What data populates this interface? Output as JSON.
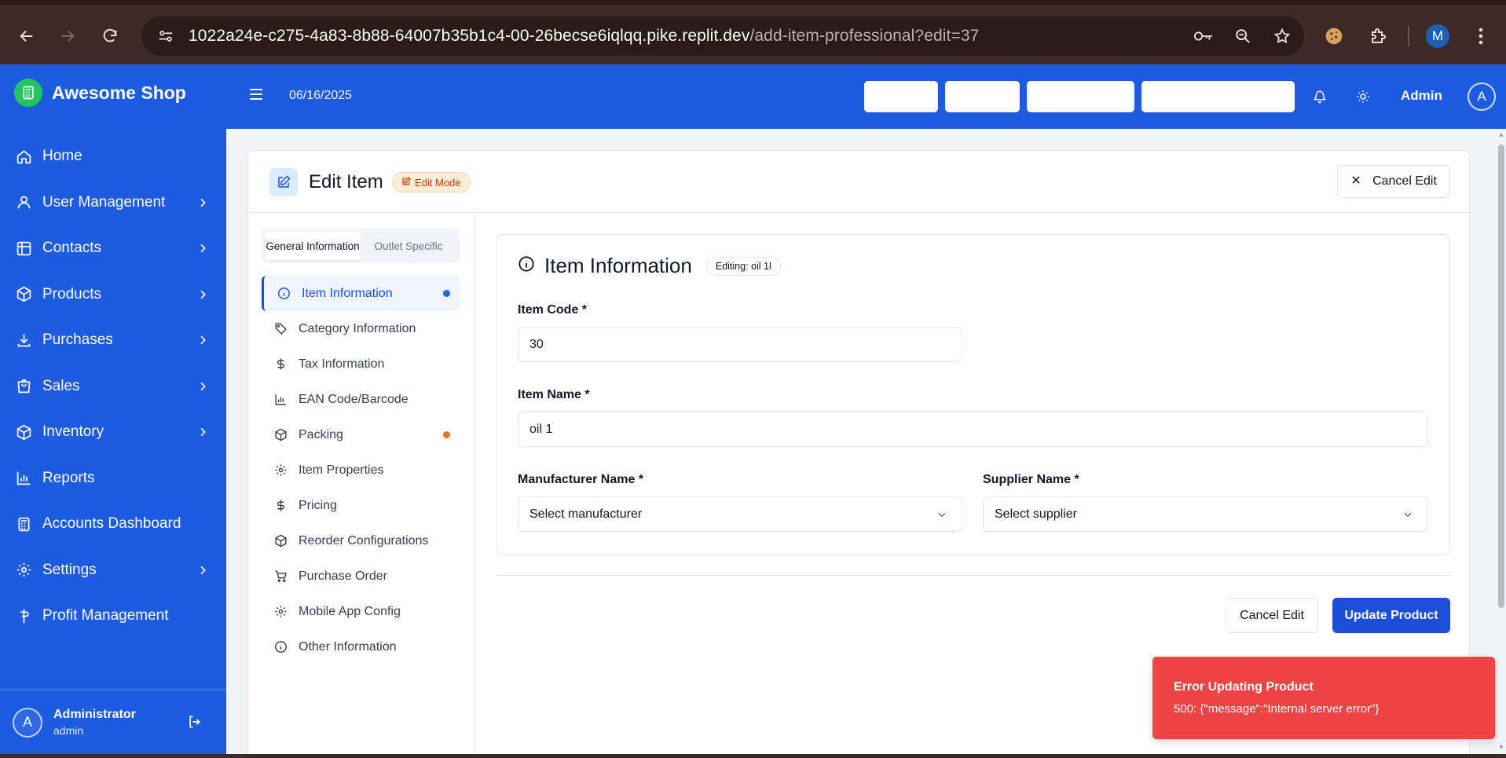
{
  "browser": {
    "url_host": "1022a24e-c275-4a83-8b88-64007b35b1c4-00-26becse6iqlqq.pike.replit.dev",
    "url_path": "/add-item-professional?edit=37",
    "profile_initial": "M"
  },
  "brand": {
    "name": "Awesome Shop",
    "color": "#1d5ce0",
    "logo_color": "#22c55e"
  },
  "sidebar": {
    "items": [
      {
        "label": "Home",
        "icon": "home-icon",
        "has_chevron": false
      },
      {
        "label": "User Management",
        "icon": "user-icon",
        "has_chevron": true
      },
      {
        "label": "Contacts",
        "icon": "contacts-icon",
        "has_chevron": true
      },
      {
        "label": "Products",
        "icon": "box-icon",
        "has_chevron": true
      },
      {
        "label": "Purchases",
        "icon": "download-icon",
        "has_chevron": true
      },
      {
        "label": "Sales",
        "icon": "shopping-bag-icon",
        "has_chevron": true
      },
      {
        "label": "Inventory",
        "icon": "box-icon",
        "has_chevron": true
      },
      {
        "label": "Reports",
        "icon": "bar-chart-icon",
        "has_chevron": false
      },
      {
        "label": "Accounts Dashboard",
        "icon": "calculator-icon",
        "has_chevron": false
      },
      {
        "label": "Settings",
        "icon": "gear-icon",
        "has_chevron": true
      },
      {
        "label": "Profit Management",
        "icon": "pin-icon",
        "has_chevron": false
      }
    ],
    "user": {
      "initial": "A",
      "name": "Administrator",
      "role": "admin"
    }
  },
  "topbar": {
    "date": "06/16/2025",
    "user_name": "Admin",
    "user_initial": "A"
  },
  "page": {
    "title": "Edit Item",
    "mode_badge": "Edit Mode",
    "cancel_top": "Cancel Edit"
  },
  "tabs": [
    {
      "label": "General Information",
      "active": true
    },
    {
      "label": "Outlet Specific",
      "active": false
    }
  ],
  "sections": [
    {
      "label": "Item Information",
      "icon": "info-icon",
      "active": true,
      "dot": "#2563eb"
    },
    {
      "label": "Category Information",
      "icon": "tag-icon",
      "active": false,
      "dot": null
    },
    {
      "label": "Tax Information",
      "icon": "dollar-icon",
      "active": false,
      "dot": null
    },
    {
      "label": "EAN Code/Barcode",
      "icon": "barcode-icon",
      "active": false,
      "dot": null
    },
    {
      "label": "Packing",
      "icon": "package-icon",
      "active": false,
      "dot": "#f97316"
    },
    {
      "label": "Item Properties",
      "icon": "gear-icon",
      "active": false,
      "dot": null
    },
    {
      "label": "Pricing",
      "icon": "dollar-icon",
      "active": false,
      "dot": null
    },
    {
      "label": "Reorder Configurations",
      "icon": "package-icon",
      "active": false,
      "dot": null
    },
    {
      "label": "Purchase Order",
      "icon": "cart-icon",
      "active": false,
      "dot": null
    },
    {
      "label": "Mobile App Config",
      "icon": "gear-icon",
      "active": false,
      "dot": null
    },
    {
      "label": "Other Information",
      "icon": "info-icon",
      "active": false,
      "dot": null
    }
  ],
  "form": {
    "title": "Item Information",
    "editing_badge": "Editing: oil 1l",
    "item_code_label": "Item Code *",
    "item_code_value": "30",
    "item_name_label": "Item Name *",
    "item_name_value": "oil 1",
    "manufacturer_label": "Manufacturer Name *",
    "manufacturer_placeholder": "Select manufacturer",
    "supplier_label": "Supplier Name *",
    "supplier_placeholder": "Select supplier"
  },
  "actions": {
    "cancel": "Cancel Edit",
    "update": "Update Product"
  },
  "toast": {
    "title": "Error Updating Product",
    "message": "500: {\"message\":\"Internal server error\"}",
    "color": "#ef4444"
  }
}
